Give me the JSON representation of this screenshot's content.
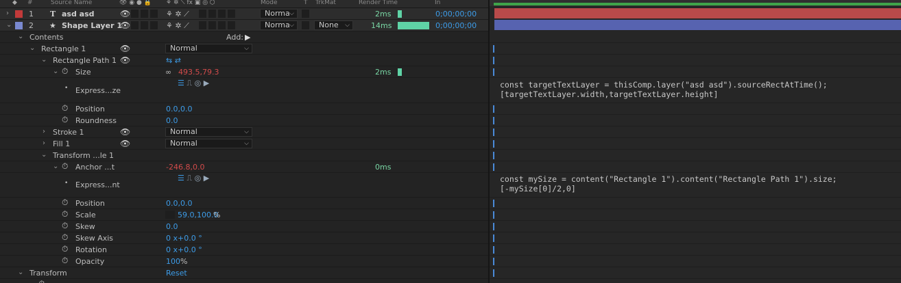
{
  "header": {
    "num": "#",
    "source_name": "Source Name",
    "mode": "Mode",
    "t": "T",
    "trkmat": "TrkMat",
    "render_time": "Render Time",
    "in": "In"
  },
  "layers": [
    {
      "num": "1",
      "type_icon": "T",
      "name": "asd asd",
      "label_color": "#c23a3a",
      "mode": "Norma",
      "render": "2ms",
      "in": "0;00;00;00",
      "bar_color": "#b84a4a"
    },
    {
      "num": "2",
      "type_icon": "★",
      "name": "Shape Layer 1",
      "label_color": "#7a89d0",
      "mode": "Norma",
      "trkmat": "None",
      "render": "14ms",
      "in": "0;00;00;00",
      "bar_color": "#5763b0"
    }
  ],
  "props": {
    "contents": "Contents",
    "add_label": "Add:",
    "rect1": "Rectangle 1",
    "rect1_mode": "Normal",
    "rectpath": "Rectangle Path 1",
    "size": "Size",
    "size_val": "493.5,79.3",
    "size_render": "2ms",
    "expr_size": "Express...ze",
    "position": "Position",
    "position_val": "0.0,0.0",
    "roundness": "Roundness",
    "roundness_val": "0.0",
    "stroke": "Stroke 1",
    "stroke_mode": "Normal",
    "fill": "Fill 1",
    "fill_mode": "Normal",
    "transform_le": "Transform ...le 1",
    "anchor": "Anchor ...t",
    "anchor_val": "-246.8,0.0",
    "anchor_render": "0ms",
    "expr_anchor": "Express...nt",
    "position2": "Position",
    "position2_val": "0.0,0.0",
    "scale": "Scale",
    "scale_val": "59.0,100.0",
    "scale_unit": "%",
    "skew": "Skew",
    "skew_val": "0.0",
    "skew_axis": "Skew Axis",
    "skew_axis_val": "0 x+0.0 °",
    "rotation": "Rotation",
    "rotation_val": "0 x+0.0 °",
    "opacity": "Opacity",
    "opacity_val": "100",
    "opacity_unit": "%",
    "transform": "Transform",
    "reset": "Reset"
  },
  "expressions": {
    "size_line1": "const targetTextLayer = thisComp.layer(\"asd asd\").sourceRectAtTime();",
    "size_line2": "[targetTextLayer.width,targetTextLayer.height]",
    "anchor_line1": "const mySize = content(\"Rectangle 1\").content(\"Rectangle Path 1\").size;",
    "anchor_line2": "[-mySize[0]/2,0]"
  },
  "colors": {
    "accent_blue": "#3d9ce8",
    "value_red": "#d34b4b",
    "render_green": "#5fd3a6"
  }
}
